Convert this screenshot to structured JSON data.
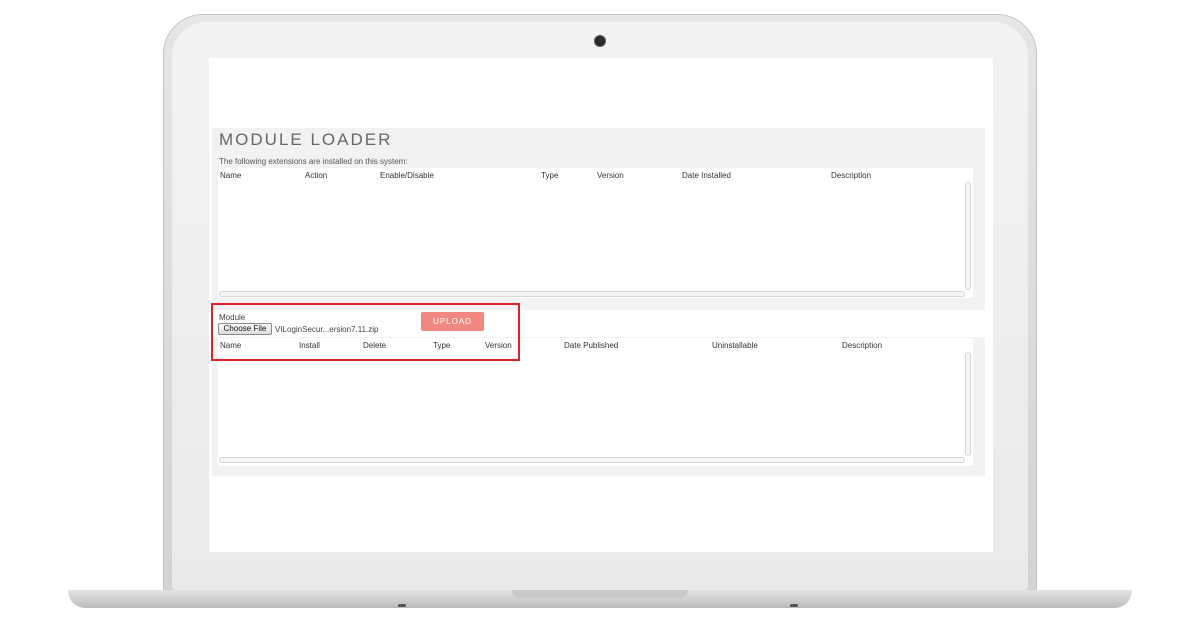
{
  "module_loader": {
    "title": "MODULE LOADER",
    "installed_caption": "The following extensions are installed on this system:",
    "installed_table": {
      "columns": [
        "Name",
        "Action",
        "Enable/Disable",
        "Type",
        "Version",
        "Date Installed",
        "Description"
      ],
      "rows": []
    },
    "upload": {
      "module_label": "Module",
      "choose_file_label": "Choose File",
      "selected_file": "VILoginSecur...ersion7.11.zip",
      "upload_label": "UPLOAD"
    },
    "available_table": {
      "columns": [
        "Name",
        "Install",
        "Delete",
        "Type",
        "Version",
        "Date Published",
        "Uninstallable",
        "Description"
      ],
      "rows": []
    }
  },
  "colors": {
    "upload_button": "#f0887f",
    "highlight_border": "#e0202a"
  }
}
